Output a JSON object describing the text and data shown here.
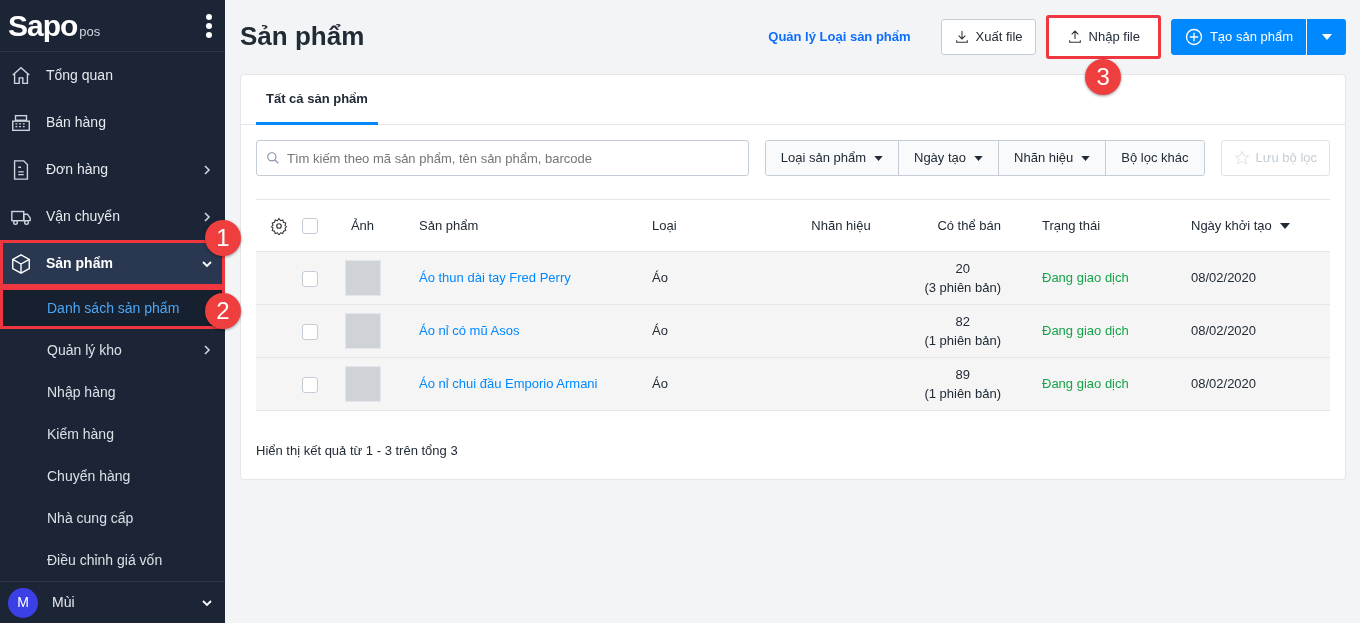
{
  "sidebar": {
    "logo": {
      "brand": "Sapo",
      "suffix": "pos"
    },
    "items": [
      {
        "label": "Tổng quan",
        "kind": "link",
        "selected": false
      },
      {
        "label": "Bán hàng",
        "kind": "link",
        "selected": false
      },
      {
        "label": "Đơn hàng",
        "kind": "group",
        "expanded": false,
        "selected": false
      },
      {
        "label": "Vận chuyển",
        "kind": "group",
        "expanded": false,
        "selected": false
      },
      {
        "label": "Sản phẩm",
        "kind": "group",
        "expanded": true,
        "selected": true,
        "annotation": "1"
      }
    ],
    "sub_items": [
      {
        "label": "Danh sách sản phẩm",
        "kind": "link",
        "selected": true,
        "annotation": "2"
      },
      {
        "label": "Quản lý kho",
        "kind": "group",
        "expanded": false,
        "selected": false
      },
      {
        "label": "Nhập hàng",
        "kind": "link",
        "selected": false
      },
      {
        "label": "Kiểm hàng",
        "kind": "link",
        "selected": false
      },
      {
        "label": "Chuyển hàng",
        "kind": "link",
        "selected": false
      },
      {
        "label": "Nhà cung cấp",
        "kind": "link",
        "selected": false
      },
      {
        "label": "Điều chỉnh giá vốn",
        "kind": "link",
        "selected": false
      }
    ],
    "user": {
      "initial": "M",
      "name": "Mùi"
    }
  },
  "header": {
    "title": "Sản phẩm",
    "link": "Quản lý Loại sản phẩm",
    "buttons": [
      {
        "label": "Xuất file",
        "kind": "outline"
      },
      {
        "label": "Nhập file",
        "kind": "outline",
        "annotation": "3"
      },
      {
        "label": "Tạo sản phẩm",
        "kind": "primary"
      }
    ]
  },
  "tabs": [
    {
      "label": "Tất cả sản phẩm",
      "selected": true
    }
  ],
  "search": {
    "placeholder": "Tìm kiếm theo mã sản phẩm, tên sản phẩm, barcode"
  },
  "filters": [
    "Loại sản phẩm",
    "Ngày tạo",
    "Nhãn hiệu",
    "Bộ lọc khác"
  ],
  "save_filter": {
    "label": "Lưu bộ lọc",
    "disabled": true
  },
  "table": {
    "all_checked": false,
    "columns": [
      "Ảnh",
      "Sản phẩm",
      "Loại",
      "Nhãn hiệu",
      "Có thể bán",
      "Trạng thái",
      "Ngày khởi tạo"
    ],
    "rows": [
      {
        "checked": false,
        "name": "Áo thun dài tay Fred Perry",
        "type": "Áo",
        "stock": "20",
        "variants": "(3 phiên bản)",
        "status": "Đang giao dịch",
        "date": "08/02/2020"
      },
      {
        "checked": false,
        "name": "Áo nỉ có mũ Asos",
        "type": "Áo",
        "stock": "82",
        "variants": "(1 phiên bản)",
        "status": "Đang giao dịch",
        "date": "08/02/2020"
      },
      {
        "checked": false,
        "name": "Áo nỉ chui đầu Emporio Armani",
        "type": "Áo",
        "stock": "89",
        "variants": "(1 phiên bản)",
        "status": "Đang giao dịch",
        "date": "08/02/2020"
      }
    ]
  },
  "footer": "Hiển thị kết quả từ 1 - 3 trên tổng 3"
}
